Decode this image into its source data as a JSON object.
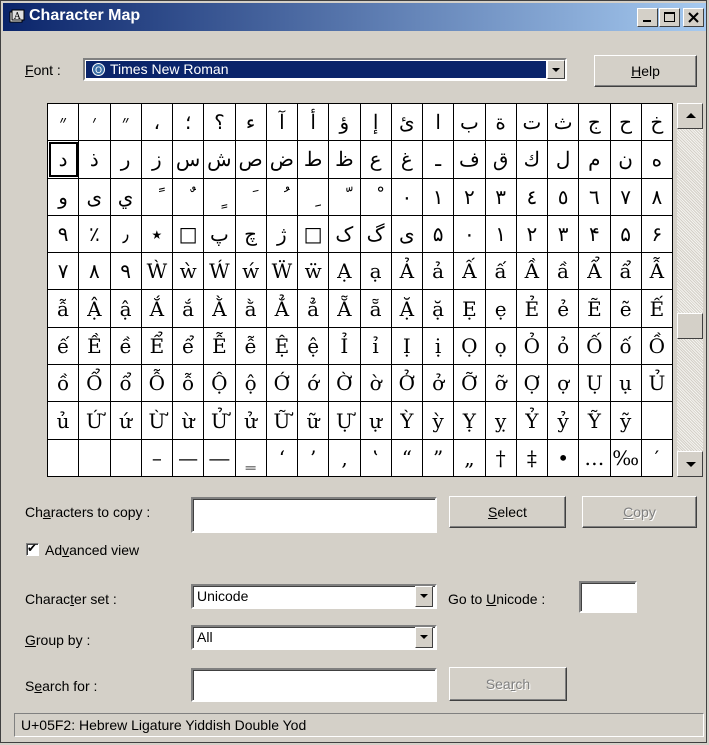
{
  "window": {
    "title": "Character Map"
  },
  "font_row": {
    "label_prefix": "",
    "label_ul": "F",
    "label_rest": "ont :",
    "selected": "Times New Roman",
    "help_ul": "H",
    "help_rest": "elp"
  },
  "grid": {
    "rows": [
      [
        "״",
        "׳",
        "״",
        "،",
        "؛",
        "؟",
        "ء",
        "آ",
        "أ",
        "ؤ",
        "إ",
        "ئ",
        "ا",
        "ب",
        "ة",
        "ت",
        "ث",
        "ج",
        "ح",
        "خ"
      ],
      [
        "د",
        "ذ",
        "ر",
        "ز",
        "س",
        "ش",
        "ص",
        "ض",
        "ط",
        "ظ",
        "ع",
        "غ",
        "ـ",
        "ف",
        "ق",
        "ك",
        "ل",
        "م",
        "ن",
        "ه"
      ],
      [
        "و",
        "ى",
        "ي",
        "ً",
        "ٌ",
        "ٍ",
        "َ",
        "ُ",
        "ِ",
        "ّ",
        "ْ",
        "٠",
        "١",
        "٢",
        "٣",
        "٤",
        "٥",
        "٦",
        "٧",
        "٨"
      ],
      [
        "٩",
        "٪",
        "٫",
        "٭",
        "□",
        "پ",
        "چ",
        "ژ",
        "□",
        "ک",
        "گ",
        "ی",
        "۵",
        "۰",
        "۱",
        "۲",
        "۳",
        "۴",
        "۵",
        "۶"
      ],
      [
        "۷",
        "۸",
        "۹",
        "Ẁ",
        "ẁ",
        "Ẃ",
        "ẃ",
        "Ẅ",
        "ẅ",
        "Ạ",
        "ạ",
        "Ả",
        "ả",
        "Ấ",
        "ấ",
        "Ầ",
        "ầ",
        "Ẩ",
        "ẩ",
        "Ẫ"
      ],
      [
        "ẫ",
        "Ậ",
        "ậ",
        "Ắ",
        "ắ",
        "Ằ",
        "ằ",
        "Ẳ",
        "ẳ",
        "Ẵ",
        "ẵ",
        "Ặ",
        "ặ",
        "Ẹ",
        "ẹ",
        "Ẻ",
        "ẻ",
        "Ẽ",
        "ẽ",
        "Ế"
      ],
      [
        "ế",
        "Ề",
        "ề",
        "Ể",
        "ể",
        "Ễ",
        "ễ",
        "Ệ",
        "ệ",
        "Ỉ",
        "ỉ",
        "Ị",
        "ị",
        "Ọ",
        "ọ",
        "Ỏ",
        "ỏ",
        "Ố",
        "ố",
        "Ồ"
      ],
      [
        "ồ",
        "Ổ",
        "ổ",
        "Ỗ",
        "ỗ",
        "Ộ",
        "ộ",
        "Ớ",
        "ớ",
        "Ờ",
        "ờ",
        "Ở",
        "ở",
        "Ỡ",
        "ỡ",
        "Ợ",
        "ợ",
        "Ụ",
        "ụ",
        "Ủ"
      ],
      [
        "ủ",
        "Ứ",
        "ứ",
        "Ừ",
        "ừ",
        "Ử",
        "ử",
        "Ữ",
        "ữ",
        "Ự",
        "ự",
        "Ỳ",
        "ỳ",
        "Ỵ",
        "ỵ",
        "Ỷ",
        "ỷ",
        "Ỹ",
        "ỹ",
        ""
      ],
      [
        "",
        "",
        "",
        "–",
        "—",
        "―",
        "‗",
        "‘",
        "’",
        "‚",
        "‛",
        "“",
        "”",
        "„",
        "†",
        "‡",
        "•",
        "…",
        "‰",
        "′"
      ]
    ]
  },
  "copy_row": {
    "label_pre": "Ch",
    "label_ul": "a",
    "label_rest": "racters to copy :",
    "value": "",
    "select_ul": "S",
    "select_rest": "elect",
    "copy_ul": "C",
    "copy_rest": "opy"
  },
  "advanced": {
    "checked_mark": "✔",
    "label_pre": "Ad",
    "label_ul": "v",
    "label_rest": "anced view"
  },
  "charset": {
    "label_pre": "Charac",
    "label_ul": "t",
    "label_rest": "er set :",
    "value": "Unicode",
    "goto_pre": "Go to ",
    "goto_ul": "U",
    "goto_rest": "nicode :",
    "goto_value": ""
  },
  "groupby": {
    "label_ul": "G",
    "label_rest": "roup by :",
    "value": "All"
  },
  "search": {
    "label_pre": "S",
    "label_ul": "e",
    "label_rest": "arch for :",
    "value": "",
    "button_pre": "Sea",
    "button_ul": "r",
    "button_rest": "ch"
  },
  "status": {
    "text": "U+05F2: Hebrew Ligature Yiddish Double Yod"
  },
  "colors": {
    "title_start": "#0a246a",
    "title_end": "#a6caf0",
    "face": "#d4d0c8",
    "highlight": "#0a246a"
  }
}
